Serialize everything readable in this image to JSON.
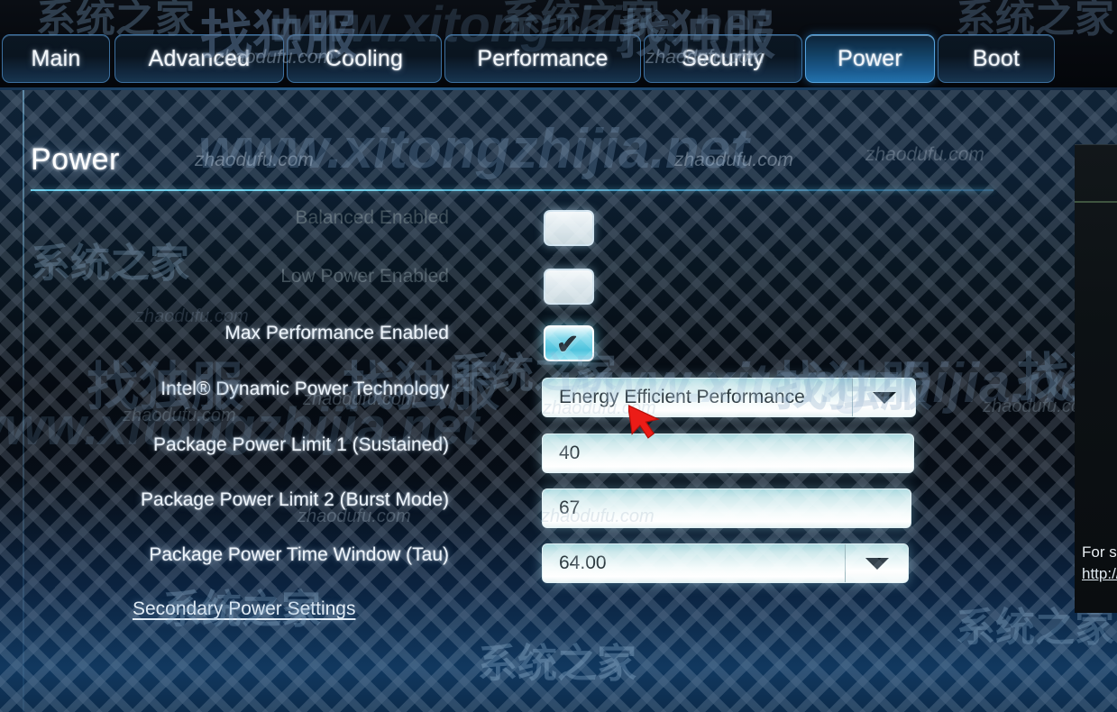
{
  "window": {
    "title": "Power"
  },
  "tabs": [
    {
      "label": "Main",
      "active": false
    },
    {
      "label": "Advanced",
      "active": false
    },
    {
      "label": "Cooling",
      "active": false
    },
    {
      "label": "Performance",
      "active": false
    },
    {
      "label": "Security",
      "active": false
    },
    {
      "label": "Power",
      "active": true
    },
    {
      "label": "Boot",
      "active": false
    }
  ],
  "page": {
    "title": "Power"
  },
  "settings": [
    {
      "label": "Balanced Enabled",
      "type": "checkbox",
      "checked": false,
      "enabled": false,
      "check_glyph": ""
    },
    {
      "label": "Low Power Enabled",
      "type": "checkbox",
      "checked": false,
      "enabled": false,
      "check_glyph": ""
    },
    {
      "label": "Max Performance Enabled",
      "type": "checkbox",
      "checked": true,
      "enabled": true,
      "check_glyph": "✔"
    },
    {
      "label": "Intel® Dynamic Power Technology",
      "type": "dropdown",
      "value": "Energy Efficient Performance",
      "enabled": true
    },
    {
      "label": "Package Power Limit 1 (Sustained)",
      "type": "input",
      "value": "40",
      "enabled": true
    },
    {
      "label": "Package Power Limit 2 (Burst Mode)",
      "type": "input",
      "value": "67",
      "enabled": true
    },
    {
      "label": "Package Power Time Window (Tau)",
      "type": "dropdown",
      "value": "64.00",
      "enabled": true
    }
  ],
  "links": {
    "secondary_power_settings": "Secondary Power Settings"
  },
  "help_panel": {
    "line1": "For sup",
    "line2": "http://w"
  },
  "watermarks": {
    "cn_brand": "找独服",
    "cn_site": "系统之家",
    "domain_a": "zhaodufu.com",
    "domain_b": "www.xitongzhijia.net"
  },
  "colors": {
    "accent": "#5fc8e8",
    "tab_active": "#2272ad",
    "field_bg": "#f4fbfb",
    "checked": "#4ec3dd",
    "cursor": "#ec1c17"
  }
}
